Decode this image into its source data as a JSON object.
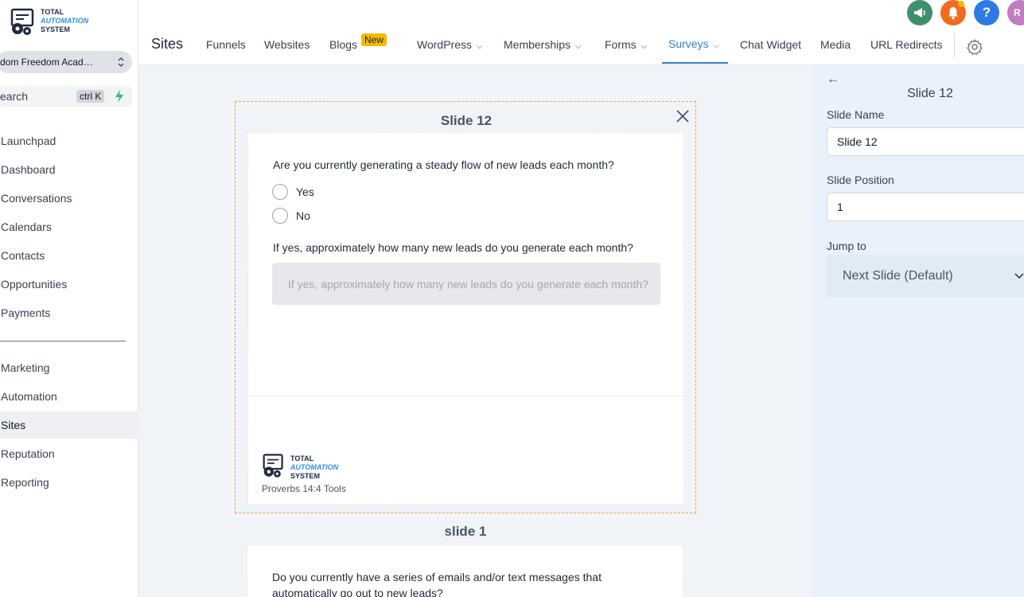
{
  "sidebar": {
    "logo": {
      "line1": "TOTAL",
      "line2": "AUTOMATION",
      "line3": "SYSTEM"
    },
    "account": "dom Freedom Acad…",
    "search": {
      "label": "earch",
      "shortcut": "ctrl K"
    },
    "items": [
      {
        "label": "Launchpad"
      },
      {
        "label": "Dashboard"
      },
      {
        "label": "Conversations"
      },
      {
        "label": "Calendars"
      },
      {
        "label": "Contacts"
      },
      {
        "label": "Opportunities"
      },
      {
        "label": "Payments"
      },
      {
        "label": "Marketing"
      },
      {
        "label": "Automation"
      },
      {
        "label": "Sites",
        "active": true
      },
      {
        "label": "Reputation"
      },
      {
        "label": "Reporting"
      }
    ]
  },
  "header": {
    "section_title": "Sites",
    "new_badge": "New",
    "avatar_initials": "R",
    "help_symbol": "?",
    "tabs": [
      {
        "label": "Funnels"
      },
      {
        "label": "Websites"
      },
      {
        "label": "Blogs"
      },
      {
        "label": "WordPress"
      },
      {
        "label": "Memberships"
      },
      {
        "label": "Forms"
      },
      {
        "label": "Surveys",
        "active": true
      },
      {
        "label": "Chat Widget"
      },
      {
        "label": "Media"
      },
      {
        "label": "URL Redirects"
      }
    ]
  },
  "slide": {
    "title": "Slide 12",
    "question1": "Are you currently generating a steady flow of new leads each month?",
    "options": [
      "Yes",
      "No"
    ],
    "question2": "If yes, approximately how many new leads do you generate each month?",
    "input_placeholder": "If yes, approximately how many new leads do you generate each month?",
    "footer_logo": {
      "line1": "TOTAL",
      "line2": "AUTOMATION",
      "line3": "SYSTEM"
    },
    "footer_text": "Proverbs 14:4 Tools"
  },
  "slide_next": {
    "title": "slide 1",
    "question": "Do you currently have a series of emails and/or text messages that automatically go out to new leads?"
  },
  "panel": {
    "title": "Slide 12",
    "slide_name_label": "Slide Name",
    "slide_name_value": "Slide 12",
    "slide_position_label": "Slide Position",
    "slide_position_value": "1",
    "jump_to_label": "Jump to",
    "jump_to_value": "Next Slide (Default)"
  },
  "colors": {
    "accent": "#2f80c6",
    "canvas_bg": "#f0f4f8",
    "panel_bg": "#e9f2fb",
    "frame_border": "#e4a24a",
    "badge_new": "#f5b800"
  },
  "icons": [
    "megaphone-icon",
    "bell-icon",
    "help-icon",
    "gear-icon",
    "close-icon",
    "back-arrow-icon",
    "lightning-icon",
    "chevron-down-icon",
    "sort-icon"
  ]
}
